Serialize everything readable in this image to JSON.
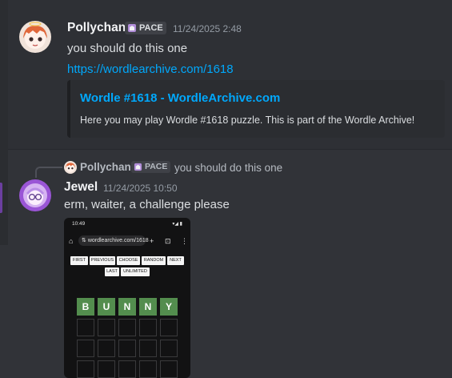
{
  "message1": {
    "author": "Pollychan",
    "tag": "PACE",
    "timestamp": "11/24/2025 2:48",
    "text": "you should do this one",
    "link": "https://wordlearchive.com/1618",
    "embed": {
      "title": "Wordle #1618 - WordleArchive.com",
      "description": "Here you may play Wordle #1618 puzzle. This is part of the Wordle Archive!"
    }
  },
  "reply": {
    "author": "Pollychan",
    "tag": "PACE",
    "text": "you should do this one"
  },
  "message2": {
    "author": "Jewel",
    "timestamp": "11/24/2025 10:50",
    "text": "erm, waiter, a challenge please",
    "image": {
      "status_time": "10:49",
      "status_right": "▾◢ ▮",
      "url": "wordlearchive.com/1618",
      "icons": {
        "home": "⌂",
        "tune": "⇅",
        "plus": "+",
        "tabs": "⊡",
        "menu": "⋮"
      },
      "nav_buttons": [
        "FIRST",
        "PREVIOUS",
        "CHOOSE",
        "RANDOM",
        "NEXT",
        "LAST",
        "UNLIMITED"
      ],
      "guess_letters": [
        "B",
        "U",
        "N",
        "N",
        "Y"
      ]
    }
  },
  "colors": {
    "background": "#313338",
    "link": "#00a8fc",
    "wordle_green": "#538d4e"
  }
}
